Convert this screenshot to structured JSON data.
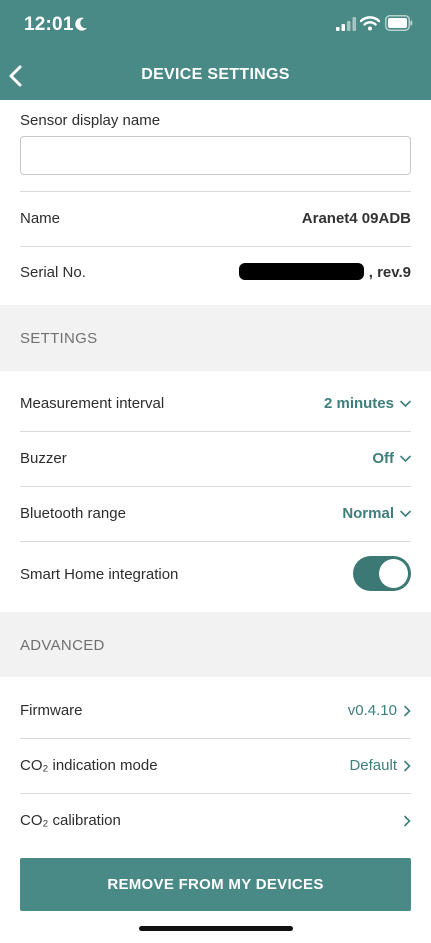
{
  "status_bar": {
    "time": "12:01"
  },
  "header": {
    "title": "DEVICE SETTINGS"
  },
  "sensor": {
    "label": "Sensor display name",
    "value": "",
    "placeholder": ""
  },
  "info": {
    "name_label": "Name",
    "name_value": "Aranet4 09ADB",
    "serial_label": "Serial No.",
    "serial_suffix": ", rev.9"
  },
  "settings": {
    "section_title": "SETTINGS",
    "measurement_interval_label": "Measurement interval",
    "measurement_interval_value": "2 minutes",
    "buzzer_label": "Buzzer",
    "buzzer_value": "Off",
    "bluetooth_range_label": "Bluetooth range",
    "bluetooth_range_value": "Normal",
    "smart_home_label": "Smart Home integration",
    "smart_home_enabled": true
  },
  "advanced": {
    "section_title": "ADVANCED",
    "firmware_label": "Firmware",
    "firmware_value": "v0.4.10",
    "co2_mode_label": "CO₂ indication mode",
    "co2_mode_value": "Default",
    "co2_calibration_label": "CO₂ calibration"
  },
  "remove_button": {
    "label": "REMOVE FROM MY DEVICES"
  },
  "colors": {
    "accent": "#4a8a86",
    "accent_text": "#3d7f7c",
    "toggle_on": "#3c7975",
    "section_bg": "#f2f2f2"
  }
}
